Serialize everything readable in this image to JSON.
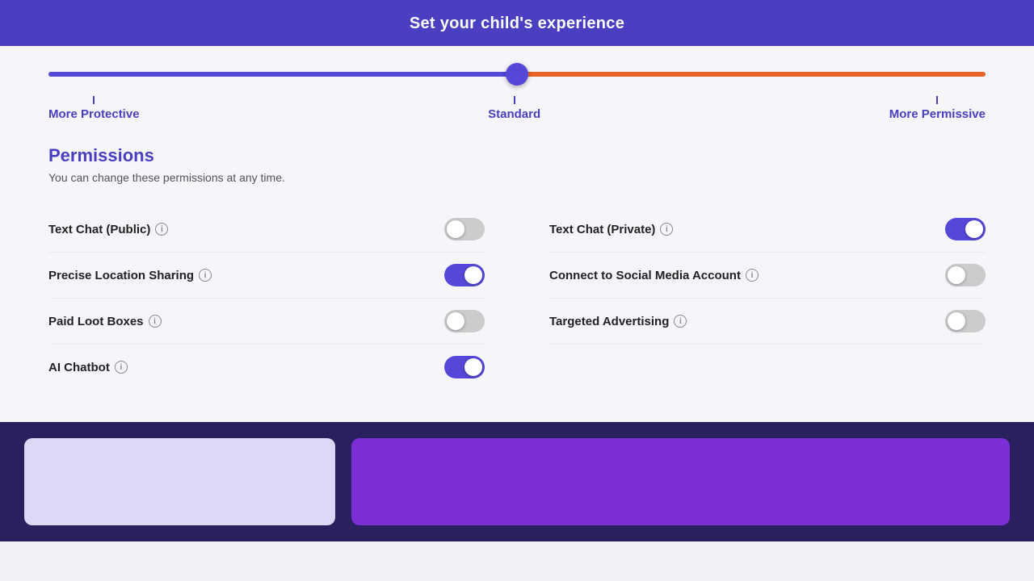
{
  "header": {
    "title": "Set your child's experience"
  },
  "slider": {
    "labels": {
      "left": "More Protective",
      "center": "Standard",
      "right": "More Permissive"
    },
    "position": 50
  },
  "permissions": {
    "title": "Permissions",
    "subtitle": "You can change these permissions at any time.",
    "items": [
      {
        "id": "text-chat-public",
        "label": "Text Chat (Public)",
        "state": "off",
        "column": "left"
      },
      {
        "id": "text-chat-private",
        "label": "Text Chat (Private)",
        "state": "on",
        "column": "right"
      },
      {
        "id": "precise-location",
        "label": "Precise Location Sharing",
        "state": "on",
        "column": "left"
      },
      {
        "id": "social-media",
        "label": "Connect to Social Media Account",
        "state": "off",
        "column": "right"
      },
      {
        "id": "paid-loot-boxes",
        "label": "Paid Loot Boxes",
        "state": "off",
        "column": "left"
      },
      {
        "id": "targeted-advertising",
        "label": "Targeted Advertising",
        "state": "off",
        "column": "right"
      },
      {
        "id": "ai-chatbot",
        "label": "AI Chatbot",
        "state": "on",
        "column": "left"
      }
    ]
  },
  "icons": {
    "info": "i"
  }
}
